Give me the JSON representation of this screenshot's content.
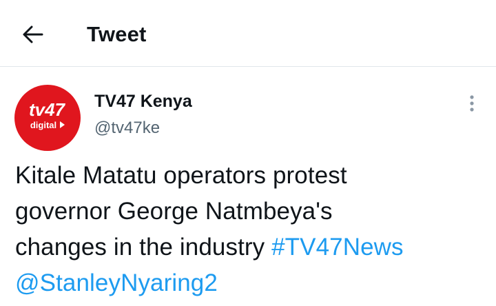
{
  "header": {
    "back_icon": "arrow-left-icon",
    "title": "Tweet"
  },
  "author": {
    "name": "TV47 Kenya",
    "handle": "@tv47ke",
    "avatar": {
      "logo_text": "tv47",
      "logo_subtext": "digital",
      "background_color": "#e0161e"
    }
  },
  "more_icon": "more-vertical-icon",
  "tweet": {
    "text_line1": "Kitale Matatu operators protest",
    "text_line2": "governor George Natmbeya's",
    "text_line3": "changes in the industry",
    "hashtag": "#TV47News",
    "mention": "@StanleyNyaring2"
  },
  "colors": {
    "link": "#1d9bf0",
    "secondary_text": "#536471",
    "divider": "#e1e6ea"
  }
}
